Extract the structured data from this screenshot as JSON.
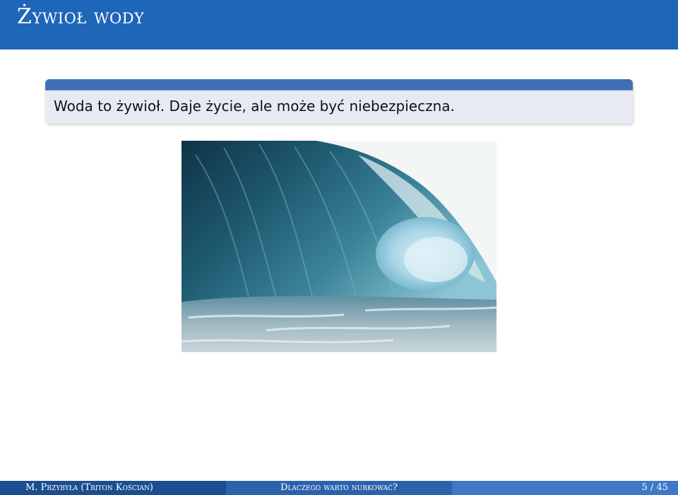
{
  "slide": {
    "title": "Żywioł wody",
    "block_text": "Woda to żywioł. Daje życie, ale może być niebezpieczna.",
    "image_description_icon": "ocean-wave-photo"
  },
  "footer": {
    "author": "M. Przybyła (Triton Kościan)",
    "presentation_title": "Dlaczego warto nurkować?",
    "page": "5 / 45"
  },
  "colors": {
    "title_bar": "#1e66b8",
    "block_head": "#3f6fb5",
    "block_body": "#e8eaf3",
    "footer_left": "#1c4e8f",
    "footer_mid": "#2c62ab",
    "footer_right": "#3e78c6"
  }
}
